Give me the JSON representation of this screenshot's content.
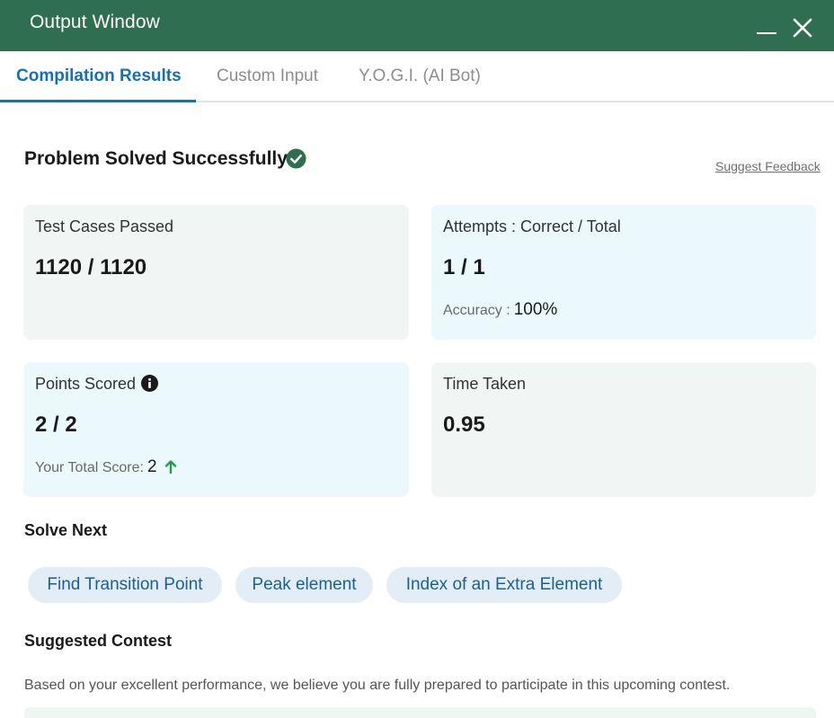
{
  "window": {
    "title": "Output Window"
  },
  "tabs": [
    {
      "label": "Compilation Results",
      "active": true
    },
    {
      "label": "Custom Input",
      "active": false
    },
    {
      "label": "Y.O.G.I. (AI Bot)",
      "active": false
    }
  ],
  "result": {
    "heading": "Problem Solved Successfully",
    "feedback_link": "Suggest Feedback"
  },
  "cards": {
    "test_cases": {
      "label": "Test Cases Passed",
      "value": "1120 / 1120"
    },
    "attempts": {
      "label": "Attempts : Correct / Total",
      "value": "1 / 1",
      "sub_label": "Accuracy :",
      "sub_value": "100%"
    },
    "points": {
      "label": "Points Scored",
      "value": "2 / 2",
      "sub_label": "Your Total Score:",
      "sub_value": "2"
    },
    "time": {
      "label": "Time Taken",
      "value": "0.95"
    }
  },
  "solve_next": {
    "title": "Solve Next",
    "items": [
      "Find Transition Point",
      "Peak element",
      "Index of an Extra Element"
    ]
  },
  "contest": {
    "title": "Suggested Contest",
    "description": "Based on your excellent performance, we believe you are fully prepared to participate in this upcoming contest."
  },
  "colors": {
    "header": "#2f6e4f",
    "accent": "#1570b8",
    "success": "#2f6e4f",
    "card_green": "#f1f6f4",
    "card_blue": "#ebf9fc",
    "chip": "#e3edf5"
  },
  "icons": {
    "minimize": "minimize-icon",
    "close": "close-icon",
    "success": "check-circle-icon",
    "info": "info-icon",
    "score_trend": "arrow-up-icon"
  }
}
